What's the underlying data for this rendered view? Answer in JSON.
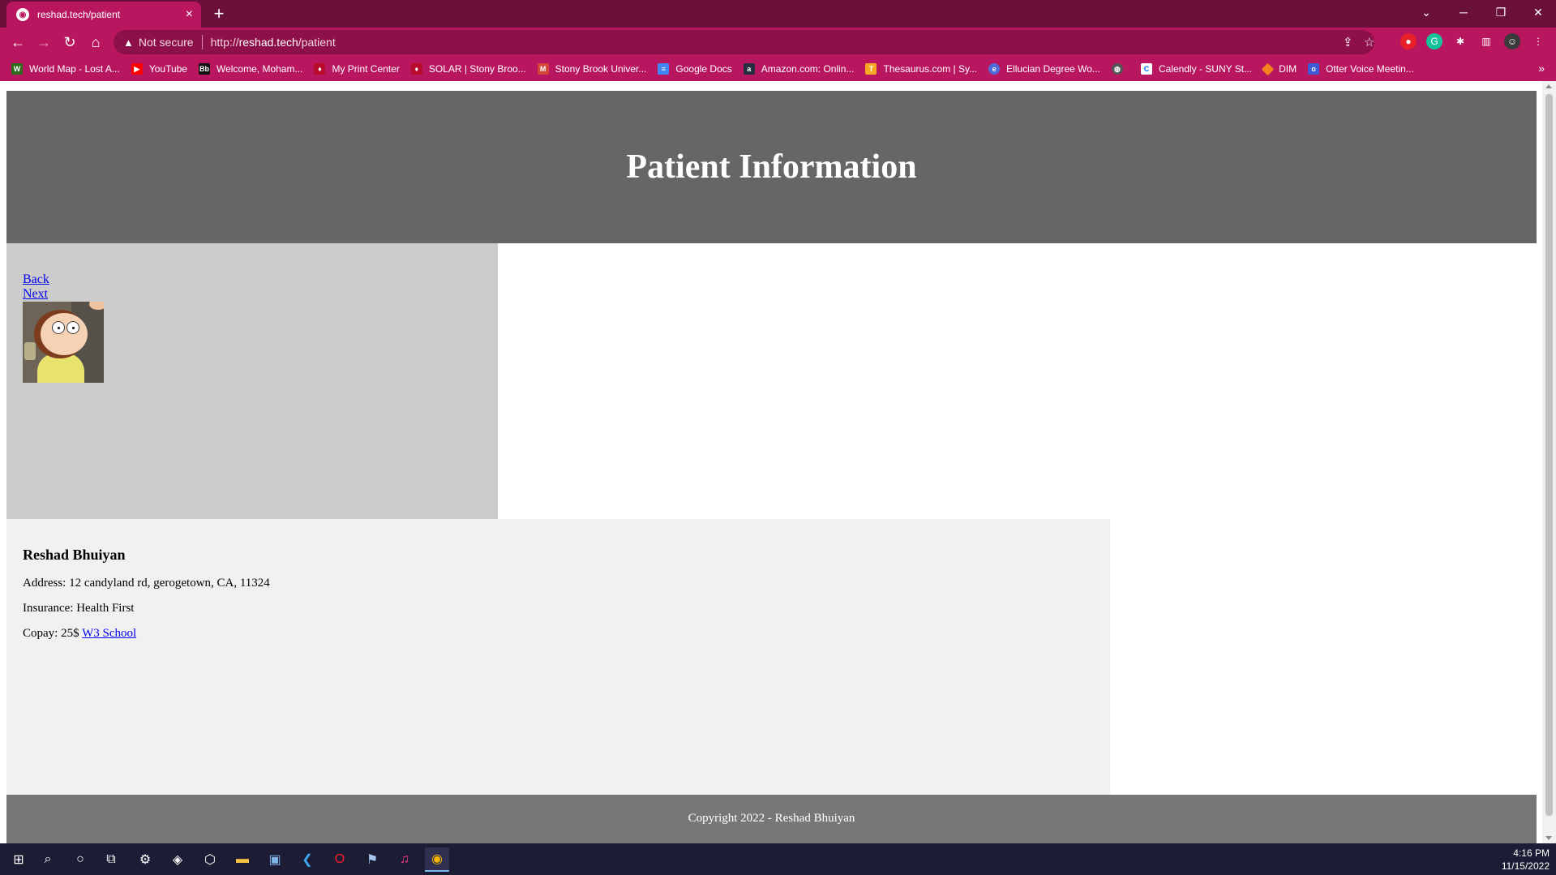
{
  "browser": {
    "tab_title": "reshad.tech/patient",
    "tab_favicon": "chrome-favicon",
    "new_tab_label": "+",
    "security_label": "Not secure",
    "url_prefix": "http://",
    "url_host": "reshad.tech",
    "url_path": "/patient",
    "theme_color": "#b8175f",
    "tabstrip_color": "#6b0f3b"
  },
  "bookmarks": [
    {
      "label": "World Map - Lost A...",
      "icon": "world-map-icon",
      "color": "#2e6b1f"
    },
    {
      "label": "YouTube",
      "icon": "youtube-icon",
      "color": "#ff0000"
    },
    {
      "label": "Welcome, Moham...",
      "icon": "blackboard-icon",
      "color": "#111111"
    },
    {
      "label": "My Print Center",
      "icon": "print-center-icon",
      "color": "#b80b2c"
    },
    {
      "label": "SOLAR | Stony Broo...",
      "icon": "solar-icon",
      "color": "#b80b2c"
    },
    {
      "label": "Stony Brook Univer...",
      "icon": "gmail-icon",
      "color": "#d44638"
    },
    {
      "label": "Google Docs",
      "icon": "google-docs-icon",
      "color": "#4285f4"
    },
    {
      "label": "Amazon.com: Onlin...",
      "icon": "amazon-icon",
      "color": "#232f3e"
    },
    {
      "label": "Thesaurus.com | Sy...",
      "icon": "thesaurus-icon",
      "color": "#f7a823"
    },
    {
      "label": "Ellucian Degree Wo...",
      "icon": "ellucian-icon",
      "color": "#4f6bd8"
    },
    {
      "label": "",
      "icon": "globe-icon",
      "color": "#555555"
    },
    {
      "label": "Calendly - SUNY St...",
      "icon": "calendly-icon",
      "color": "#ffffff"
    },
    {
      "label": "DIM",
      "icon": "dim-icon",
      "color": "#f58220"
    },
    {
      "label": "Otter Voice Meetin...",
      "icon": "otter-icon",
      "color": "#3c5bd6"
    }
  ],
  "page": {
    "header_title": "Patient Information",
    "nav": {
      "back_label": "Back",
      "next_label": "Next"
    },
    "patient": {
      "name": "Reshad Bhuiyan",
      "address": "Address: 12 candyland rd, gerogetown, CA, 11324",
      "insurance": "Insurance: Health First",
      "copay": "Copay: 25$",
      "copay_link": "W3 School"
    },
    "footer": "Copyright 2022 - Reshad Bhuiyan"
  },
  "taskbar": {
    "time": "4:16 PM",
    "date": "11/15/2022"
  }
}
